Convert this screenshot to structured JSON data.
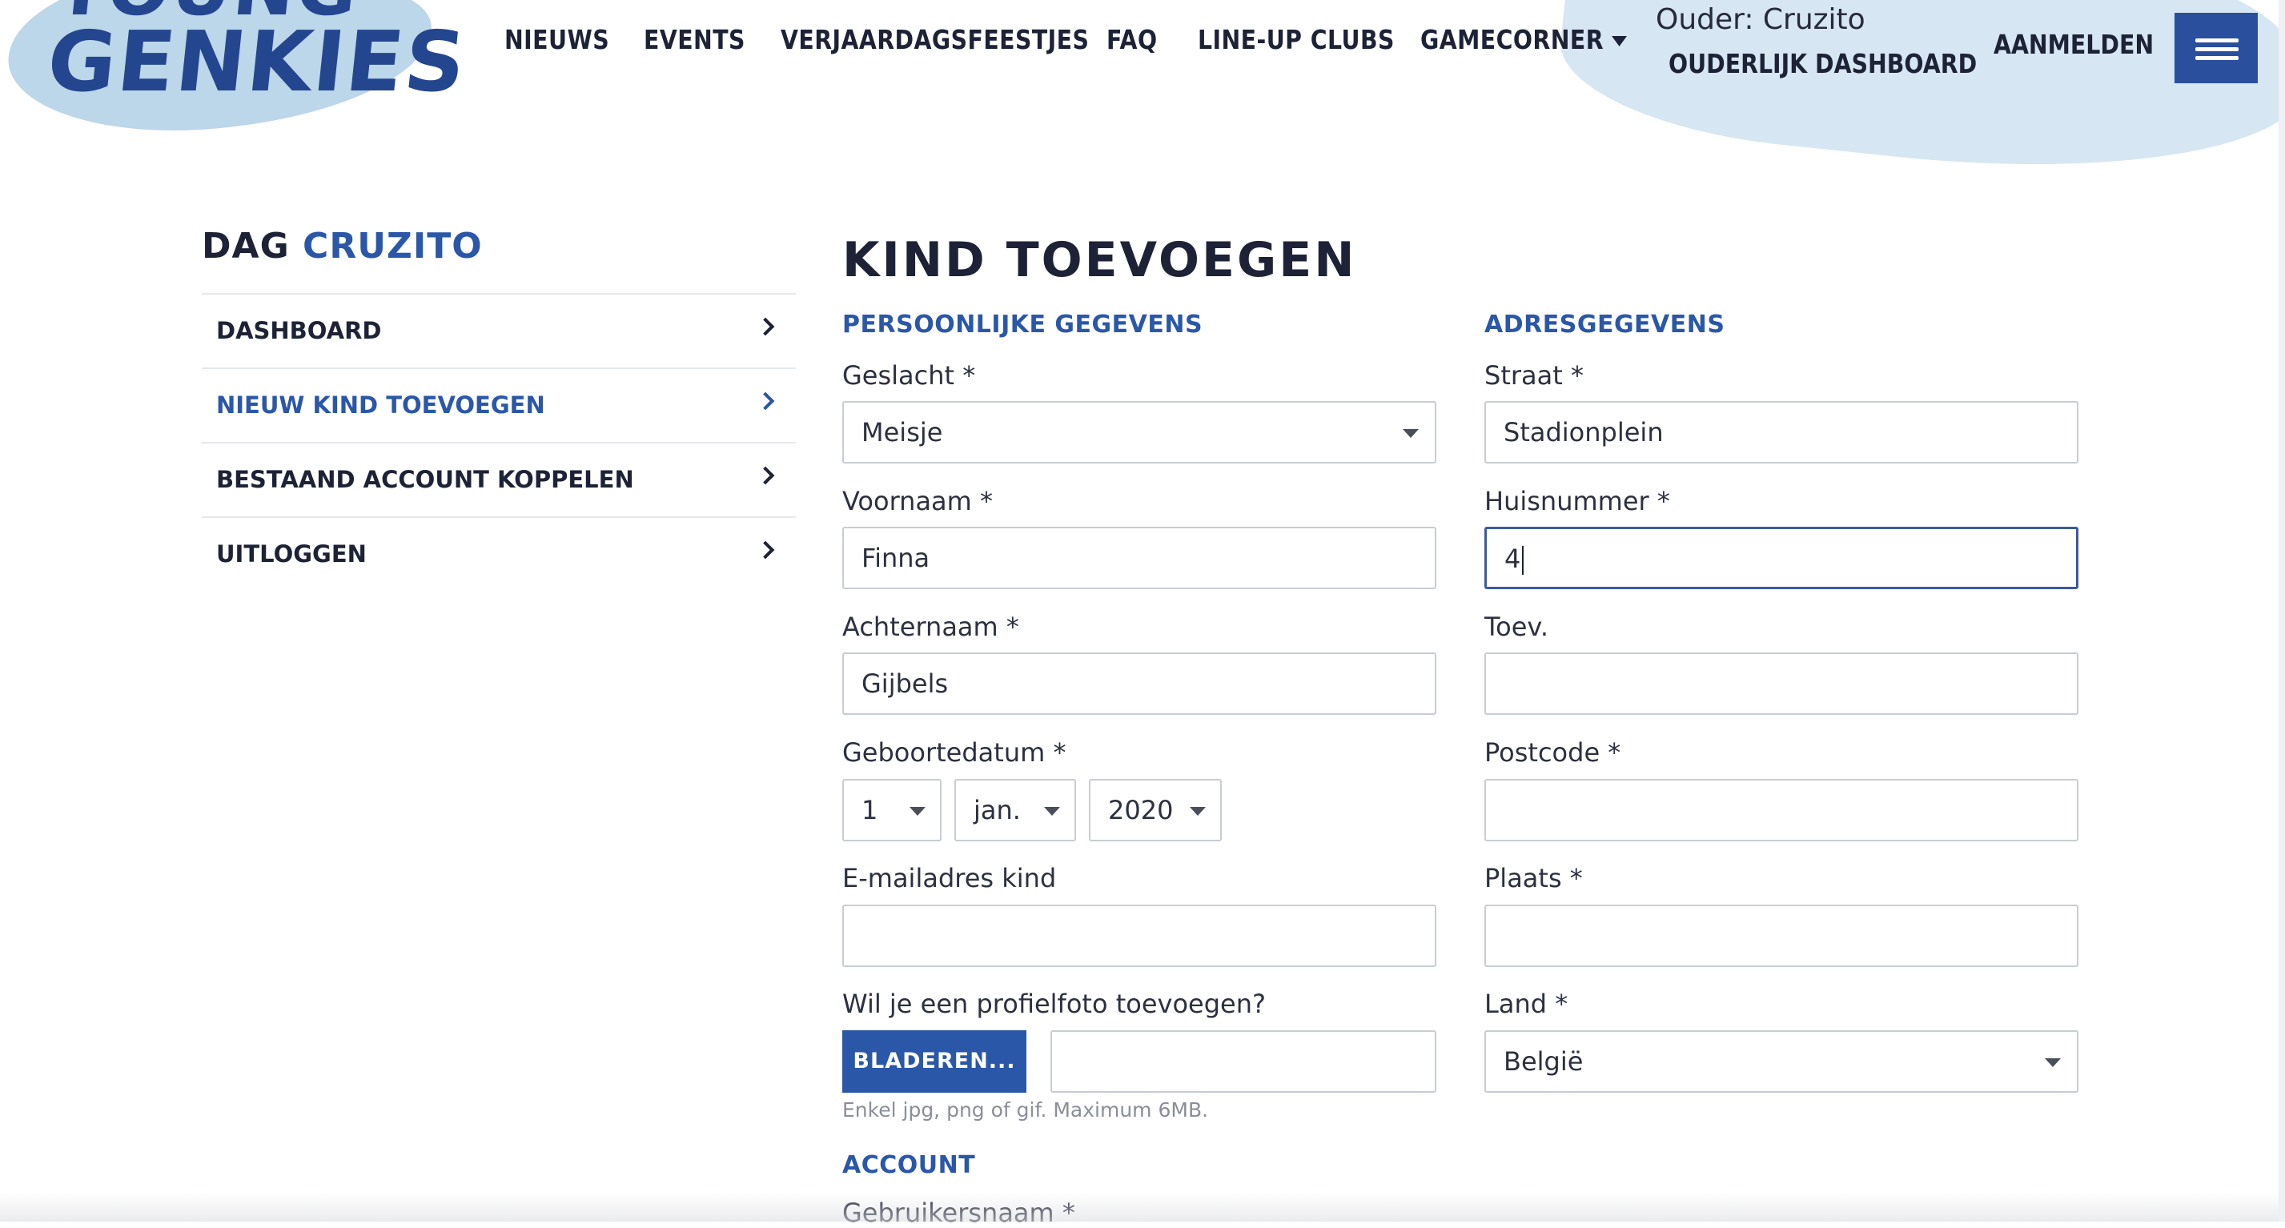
{
  "logo": {
    "line1": "YOUNG",
    "line2": "GENKIES"
  },
  "nav": {
    "items": [
      "NIEUWS",
      "EVENTS",
      "VERJAARDAGSFEESTJES",
      "FAQ",
      "LINE-UP CLUBS",
      "GAMECORNER"
    ],
    "parent_label": "Ouder: Cruzito",
    "parent_dashboard": "OUDERLIJK DASHBOARD",
    "login": "AANMELDEN",
    "menu_icon": "hamburger-icon"
  },
  "sidebar": {
    "greeting_prefix": "DAG",
    "greeting_name": "CRUZITO",
    "items": [
      {
        "label": "DASHBOARD"
      },
      {
        "label": "NIEUW KIND TOEVOEGEN",
        "active": true
      },
      {
        "label": "BESTAAND ACCOUNT KOPPELEN"
      },
      {
        "label": "UITLOGGEN"
      }
    ]
  },
  "form": {
    "title": "KIND TOEVOEGEN",
    "personal": {
      "section": "PERSOONLIJKE GEGEVENS",
      "gender_label": "Geslacht *",
      "gender_value": "Meisje",
      "firstname_label": "Voornaam *",
      "firstname_value": "Finna",
      "lastname_label": "Achternaam *",
      "lastname_value": "Gijbels",
      "birthdate_label": "Geboortedatum *",
      "birth_day": "1",
      "birth_month": "jan.",
      "birth_year": "2020",
      "email_label": "E-mailadres kind",
      "email_value": "",
      "photo_label": "Wil je een profielfoto toevoegen?",
      "browse_label": "BLADEREN...",
      "photo_value": "",
      "photo_hint": "Enkel jpg, png of gif. Maximum 6MB."
    },
    "address": {
      "section": "ADRESGEGEVENS",
      "street_label": "Straat *",
      "street_value": "Stadionplein",
      "number_label": "Huisnummer *",
      "number_value": "4",
      "addition_label": "Toev.",
      "addition_value": "",
      "postcode_label": "Postcode *",
      "postcode_value": "",
      "city_label": "Plaats *",
      "city_value": "",
      "country_label": "Land *",
      "country_value": "België"
    },
    "account": {
      "section": "ACCOUNT",
      "username_label": "Gebruikersnaam *"
    }
  }
}
